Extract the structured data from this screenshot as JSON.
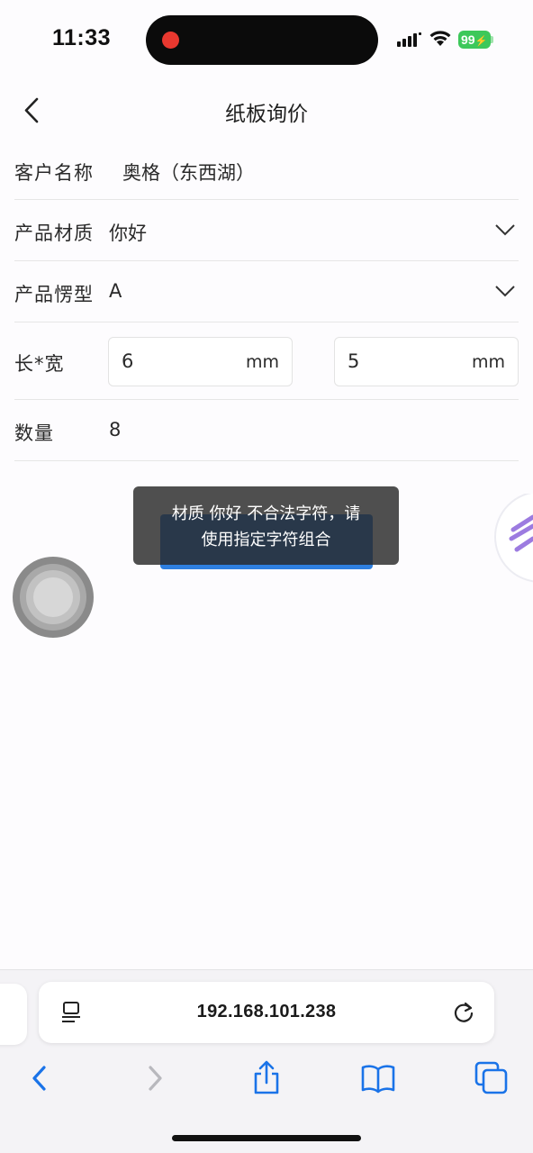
{
  "status_bar": {
    "time": "11:33",
    "battery": "99"
  },
  "nav": {
    "title": "纸板询价",
    "back_icon": "chevron-left-icon"
  },
  "form": {
    "customer": {
      "label": "客户名称",
      "value": "奥格（东西湖）"
    },
    "material": {
      "label": "产品材质",
      "value": "你好"
    },
    "flute": {
      "label": "产品愣型",
      "value": "A"
    },
    "size": {
      "label": "长*宽",
      "length": "6",
      "width": "5",
      "unit": "mm"
    },
    "quantity": {
      "label": "数量",
      "value": "8"
    }
  },
  "toast": {
    "line1": "材质 你好 不合法字符，请",
    "line2": "使用指定字符组合"
  },
  "browser": {
    "url": "192.168.101.238"
  },
  "colors": {
    "accent": "#2e7fe0",
    "toolbar_blue": "#1a73e8",
    "battery_green": "#3dc85a",
    "recording_red": "#e8382f"
  }
}
